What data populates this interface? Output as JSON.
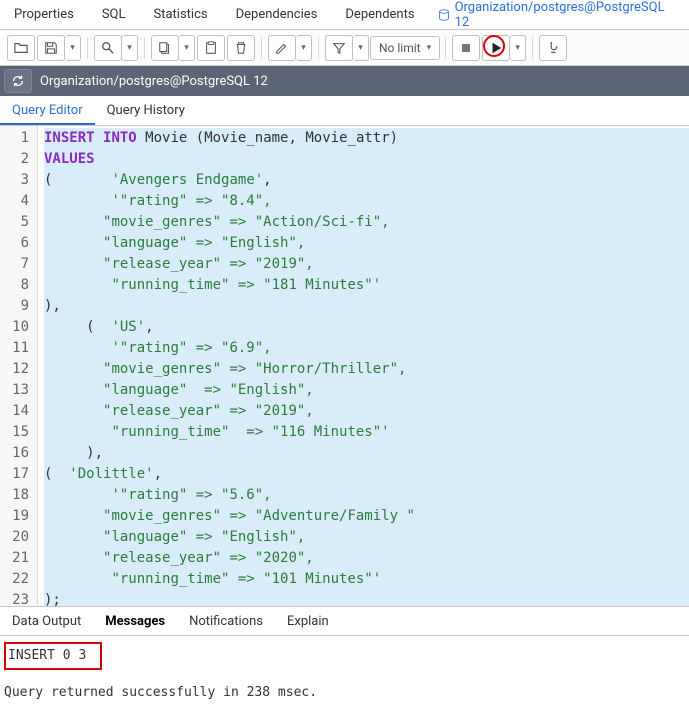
{
  "top_tabs": {
    "properties": "Properties",
    "sql": "SQL",
    "statistics": "Statistics",
    "dependencies": "Dependencies",
    "dependents": "Dependents",
    "active_label": "Organization/postgres@PostgreSQL 12"
  },
  "toolbar": {
    "nolimit": "No limit"
  },
  "connection_bar": {
    "label": "Organization/postgres@PostgreSQL 12"
  },
  "sub_tabs": {
    "query_editor": "Query Editor",
    "query_history": "Query History"
  },
  "code_lines": [
    {
      "n": 1,
      "tokens": [
        [
          "kw",
          "INSERT"
        ],
        [
          "sp",
          " "
        ],
        [
          "kw",
          "INTO"
        ],
        [
          "sp",
          " "
        ],
        [
          "ident",
          "Movie"
        ],
        [
          "sp",
          " "
        ],
        [
          "punc",
          "("
        ],
        [
          "ident",
          "Movie_name"
        ],
        [
          "punc",
          ","
        ],
        [
          "sp",
          " "
        ],
        [
          "ident",
          "Movie_attr"
        ],
        [
          "punc",
          ")"
        ]
      ]
    },
    {
      "n": 2,
      "tokens": [
        [
          "kw",
          "VALUES"
        ]
      ]
    },
    {
      "n": 3,
      "tokens": [
        [
          "punc",
          "("
        ],
        [
          "sp",
          "       "
        ],
        [
          "str",
          "'Avengers Endgame'"
        ],
        [
          "punc",
          ","
        ]
      ]
    },
    {
      "n": 4,
      "tokens": [
        [
          "sp",
          "        "
        ],
        [
          "str",
          "'\"rating\" => \"8.4\","
        ]
      ]
    },
    {
      "n": 5,
      "tokens": [
        [
          "sp",
          "       "
        ],
        [
          "str",
          "\"movie_genres\" => \"Action/Sci-fi\","
        ]
      ]
    },
    {
      "n": 6,
      "tokens": [
        [
          "sp",
          "       "
        ],
        [
          "str",
          "\"language\" => \"English\","
        ]
      ]
    },
    {
      "n": 7,
      "tokens": [
        [
          "sp",
          "       "
        ],
        [
          "str",
          "\"release_year\" => \"2019\","
        ]
      ]
    },
    {
      "n": 8,
      "tokens": [
        [
          "sp",
          "        "
        ],
        [
          "str",
          "\"running_time\" => \"181 Minutes\"'"
        ]
      ]
    },
    {
      "n": 9,
      "tokens": [
        [
          "punc",
          "),"
        ]
      ]
    },
    {
      "n": 10,
      "tokens": [
        [
          "sp",
          "     "
        ],
        [
          "punc",
          "("
        ],
        [
          "sp",
          "  "
        ],
        [
          "str",
          "'US'"
        ],
        [
          "punc",
          ","
        ]
      ]
    },
    {
      "n": 11,
      "tokens": [
        [
          "sp",
          "        "
        ],
        [
          "str",
          "'\"rating\" => \"6.9\","
        ]
      ]
    },
    {
      "n": 12,
      "tokens": [
        [
          "sp",
          "       "
        ],
        [
          "str",
          "\"movie_genres\" => \"Horror/Thriller\","
        ]
      ]
    },
    {
      "n": 13,
      "tokens": [
        [
          "sp",
          "       "
        ],
        [
          "str",
          "\"language\"  => \"English\","
        ]
      ]
    },
    {
      "n": 14,
      "tokens": [
        [
          "sp",
          "       "
        ],
        [
          "str",
          "\"release_year\" => \"2019\","
        ]
      ]
    },
    {
      "n": 15,
      "tokens": [
        [
          "sp",
          "        "
        ],
        [
          "str",
          "\"running_time\"  => \"116 Minutes\"'"
        ]
      ]
    },
    {
      "n": 16,
      "tokens": [
        [
          "sp",
          "     "
        ],
        [
          "punc",
          "),"
        ]
      ]
    },
    {
      "n": 17,
      "tokens": [
        [
          "punc",
          "("
        ],
        [
          "sp",
          "  "
        ],
        [
          "str",
          "'Dolittle'"
        ],
        [
          "punc",
          ","
        ]
      ]
    },
    {
      "n": 18,
      "tokens": [
        [
          "sp",
          "        "
        ],
        [
          "str",
          "'\"rating\" => \"5.6\","
        ]
      ]
    },
    {
      "n": 19,
      "tokens": [
        [
          "sp",
          "       "
        ],
        [
          "str",
          "\"movie_genres\" => \"Adventure/Family \""
        ]
      ]
    },
    {
      "n": 20,
      "tokens": [
        [
          "sp",
          "       "
        ],
        [
          "str",
          "\"language\" => \"English\","
        ]
      ]
    },
    {
      "n": 21,
      "tokens": [
        [
          "sp",
          "       "
        ],
        [
          "str",
          "\"release_year\" => \"2020\","
        ]
      ]
    },
    {
      "n": 22,
      "tokens": [
        [
          "sp",
          "        "
        ],
        [
          "str",
          "\"running_time\" => \"101 Minutes\"'"
        ]
      ]
    },
    {
      "n": 23,
      "tokens": [
        [
          "punc",
          ");"
        ]
      ]
    }
  ],
  "output_tabs": {
    "data_output": "Data Output",
    "messages": "Messages",
    "notifications": "Notifications",
    "explain": "Explain"
  },
  "messages": {
    "result": "INSERT 0 3",
    "summary": "Query returned successfully in 238 msec."
  }
}
